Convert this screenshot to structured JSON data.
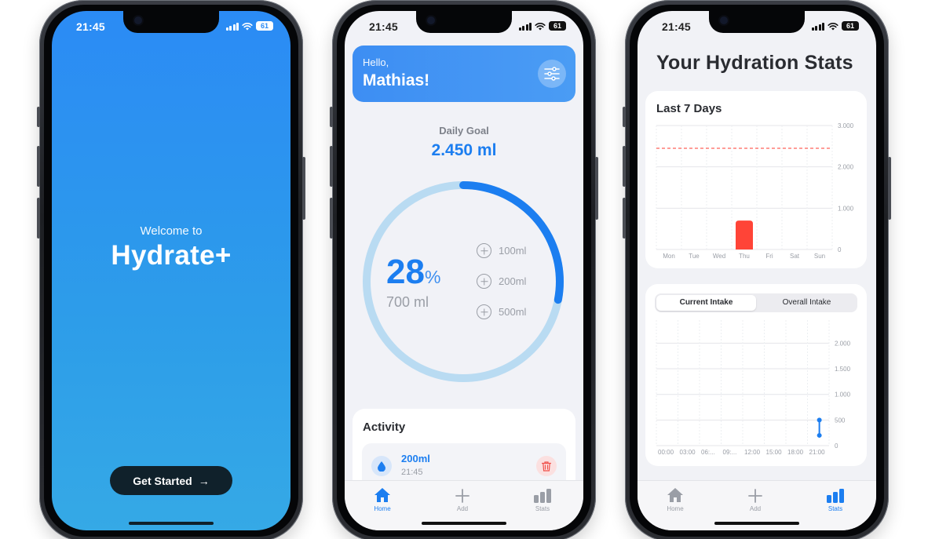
{
  "status_bar": {
    "time": "21:45",
    "battery": "61"
  },
  "onboarding": {
    "welcome": "Welcome to",
    "app_name": "Hydrate+",
    "cta_label": "Get Started",
    "cta_arrow": "→"
  },
  "home": {
    "hello": "Hello,",
    "name": "Mathias!",
    "daily_goal_label": "Daily Goal",
    "daily_goal_value": "2.450 ml",
    "percent": "28",
    "percent_sign": "%",
    "consumed": "700 ml",
    "progress_fraction": 0.28,
    "quick_add": [
      "100ml",
      "200ml",
      "500ml"
    ],
    "activity_title": "Activity",
    "activity_entries": [
      {
        "amount": "200ml",
        "time": "21:45"
      }
    ]
  },
  "tabs": [
    {
      "label": "Home",
      "icon": "house-icon"
    },
    {
      "label": "Add",
      "icon": "plus-icon"
    },
    {
      "label": "Stats",
      "icon": "bar-chart-icon"
    }
  ],
  "stats": {
    "title": "Your Hydration Stats",
    "card1_title": "Last 7 Days",
    "segment_options": [
      "Current Intake",
      "Overall Intake"
    ],
    "selected_segment": "Current Intake"
  },
  "colors": {
    "accent": "#1c7ef0",
    "onboarding_gradient_top": "#2b8bf5",
    "ring_track": "#b9dbf2",
    "bar": "#ff4437",
    "goal_line": "#ff3b30"
  },
  "chart_data": [
    {
      "type": "bar",
      "title": "Last 7 Days",
      "categories": [
        "Mon",
        "Tue",
        "Wed",
        "Thu",
        "Fri",
        "Sat",
        "Sun"
      ],
      "values": [
        0,
        0,
        0,
        700,
        0,
        0,
        0
      ],
      "goal_line": 2450,
      "yticks": [
        "0",
        "1.000",
        "2.000",
        "3.000"
      ],
      "ylim": [
        0,
        3000
      ],
      "grid": true,
      "y_axis_side": "right"
    },
    {
      "type": "line",
      "x": [
        "21:00",
        "21:00"
      ],
      "values": [
        500,
        200
      ],
      "xticks": [
        "00:00",
        "03:00",
        "06:...",
        "09:...",
        "12:00",
        "15:00",
        "18:00",
        "21:00"
      ],
      "yticks": [
        "0",
        "500",
        "1.000",
        "1.500",
        "2.000"
      ],
      "ylim": [
        0,
        2450
      ],
      "grid": true,
      "y_axis_side": "right"
    }
  ]
}
